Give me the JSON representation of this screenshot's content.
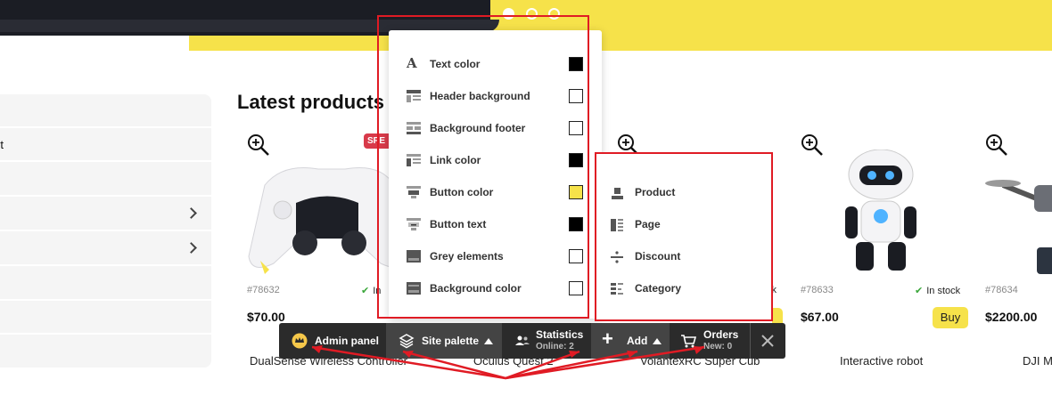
{
  "section_title": "Latest products",
  "sidebar": {
    "items": [
      {
        "label": ""
      },
      {
        "label": "rt"
      },
      {
        "label": ""
      },
      {
        "label": "",
        "has_submenu": true
      },
      {
        "label": "",
        "has_submenu": true
      },
      {
        "label": ""
      },
      {
        "label": ""
      },
      {
        "label": ""
      }
    ]
  },
  "products": [
    {
      "sku": "#78632",
      "stock": "In",
      "price": "$70.00",
      "name": "DualSense Wireless Controller",
      "badge": "SPE"
    },
    {
      "name": "Oculus Quest 2"
    },
    {
      "stock": "ck",
      "name": "VolantexRC Super Cub"
    },
    {
      "sku": "#78633",
      "stock": "In stock",
      "price": "$67.00",
      "buy": "Buy",
      "name": "Interactive robot"
    },
    {
      "sku": "#78634",
      "price": "$2200.00",
      "name": "DJI Ma"
    }
  ],
  "palette": {
    "items": [
      {
        "label": "Text color",
        "icon": "text-color-icon",
        "color": "#000000"
      },
      {
        "label": "Header background",
        "icon": "header-layout-icon",
        "color": "#ffffff"
      },
      {
        "label": "Background footer",
        "icon": "footer-layout-icon",
        "color": "#ffffff"
      },
      {
        "label": "Link color",
        "icon": "link-layout-icon",
        "color": "#000000"
      },
      {
        "label": "Button color",
        "icon": "button-layout-icon",
        "color": "#f6e24a"
      },
      {
        "label": "Button text",
        "icon": "button-text-icon",
        "color": "#000000"
      },
      {
        "label": "Grey elements",
        "icon": "grey-layout-icon",
        "color": "#ffffff"
      },
      {
        "label": "Background color",
        "icon": "background-layout-icon",
        "color": "#ffffff"
      }
    ]
  },
  "add_menu": {
    "items": [
      {
        "label": "Product",
        "icon": "product-icon"
      },
      {
        "label": "Page",
        "icon": "page-icon"
      },
      {
        "label": "Discount",
        "icon": "discount-icon"
      },
      {
        "label": "Category",
        "icon": "category-icon"
      }
    ]
  },
  "admin_bar": {
    "admin_panel": "Admin panel",
    "site_palette": "Site palette",
    "statistics": "Statistics",
    "online": "Online: 2",
    "add": "Add",
    "orders": "Orders",
    "new_orders": "New: 0"
  },
  "colors": {
    "accent": "#f6e24a",
    "admin_bar": "#2b2b2b",
    "annotation": "#e01b24",
    "badge": "#d83a4a"
  }
}
